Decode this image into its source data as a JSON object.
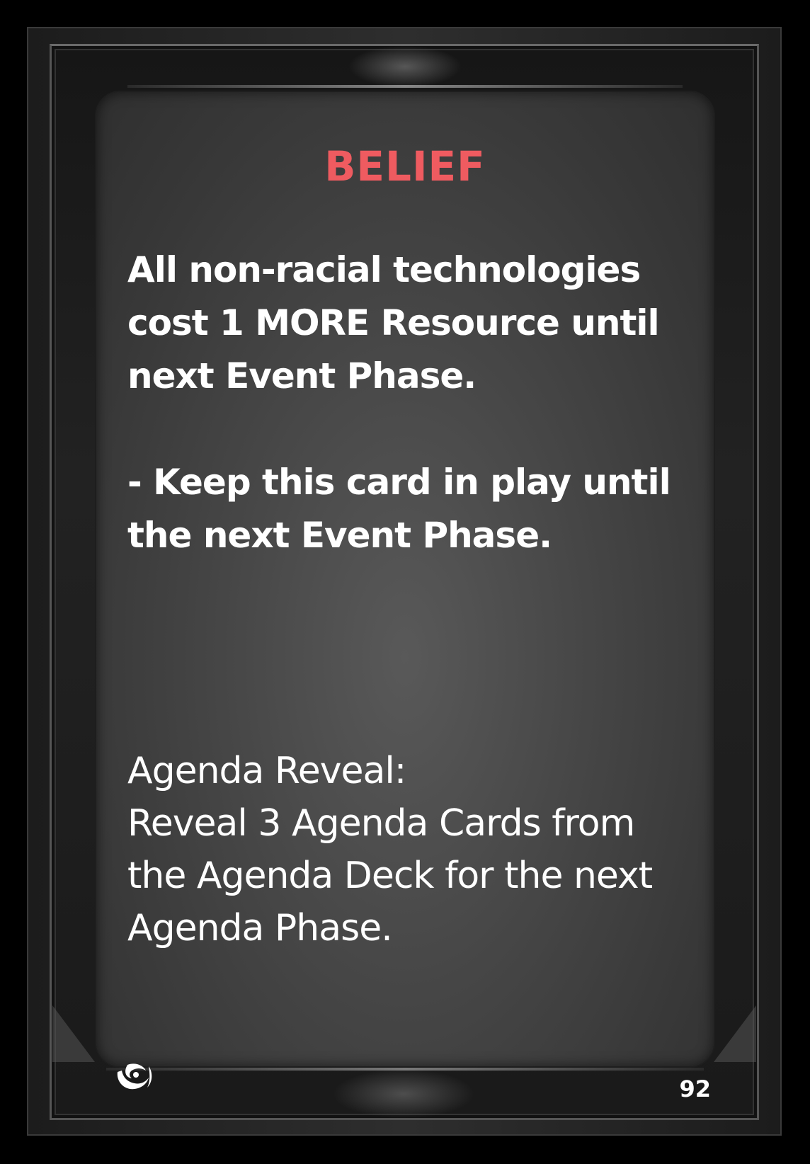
{
  "card": {
    "title": "BELIEF",
    "effect_line_1": "All non-racial technologies",
    "effect_line_2": "cost 1 MORE Resource until",
    "effect_line_3": "next Event Phase.",
    "keep_line_1": "- Keep this card in play until",
    "keep_line_2": "the next Event Phase.",
    "reveal_heading": "Agenda Reveal:",
    "reveal_line_1": "Reveal 3 Agenda Cards from",
    "reveal_line_2": "the Agenda Deck for the next",
    "reveal_line_3": "Agenda Phase.",
    "number": "92",
    "logo_icon": "swirl-logo-icon"
  },
  "colors": {
    "title": "#ef5b60",
    "text": "#ffffff",
    "panel": "#474747",
    "background": "#000000"
  }
}
